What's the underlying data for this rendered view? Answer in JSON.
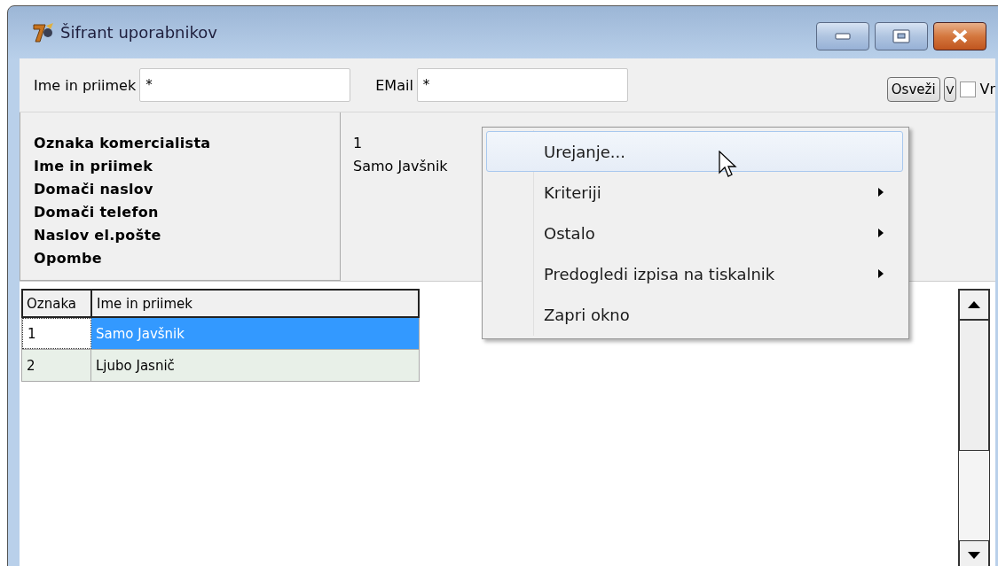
{
  "window": {
    "title": "Šifrant uporabnikov"
  },
  "filters": [
    {
      "label": "Ime in priimek",
      "value": "*"
    },
    {
      "label": "EMail",
      "value": "*"
    }
  ],
  "toolbar": {
    "refresh_button": "Osveži",
    "v_button": "V",
    "checkbox": {
      "label": "Vr",
      "checked": false
    }
  },
  "details": {
    "labels": [
      "Oznaka komercialista",
      "Ime in priimek",
      "Domači naslov",
      "Domači telefon",
      "Naslov el.pošte",
      "Opombe"
    ],
    "values": [
      "1",
      "Samo Javšnik"
    ]
  },
  "table": {
    "columns": [
      "Oznaka",
      "Ime in priimek"
    ],
    "rows": [
      {
        "cells": [
          "1",
          "Samo Javšnik"
        ],
        "selected": true
      },
      {
        "cells": [
          "2",
          "Ljubo Jasnič"
        ],
        "selected": false
      }
    ]
  },
  "context_menu": {
    "items": [
      {
        "label": "Urejanje...",
        "highlighted": true,
        "submenu": false
      },
      {
        "label": "Kriteriji",
        "highlighted": false,
        "submenu": true
      },
      {
        "label": "Ostalo",
        "highlighted": false,
        "submenu": true
      },
      {
        "label": "Predogledi izpisa na tiskalnik",
        "highlighted": false,
        "submenu": true
      },
      {
        "label": "Zapri okno",
        "highlighted": false,
        "submenu": false
      }
    ]
  }
}
